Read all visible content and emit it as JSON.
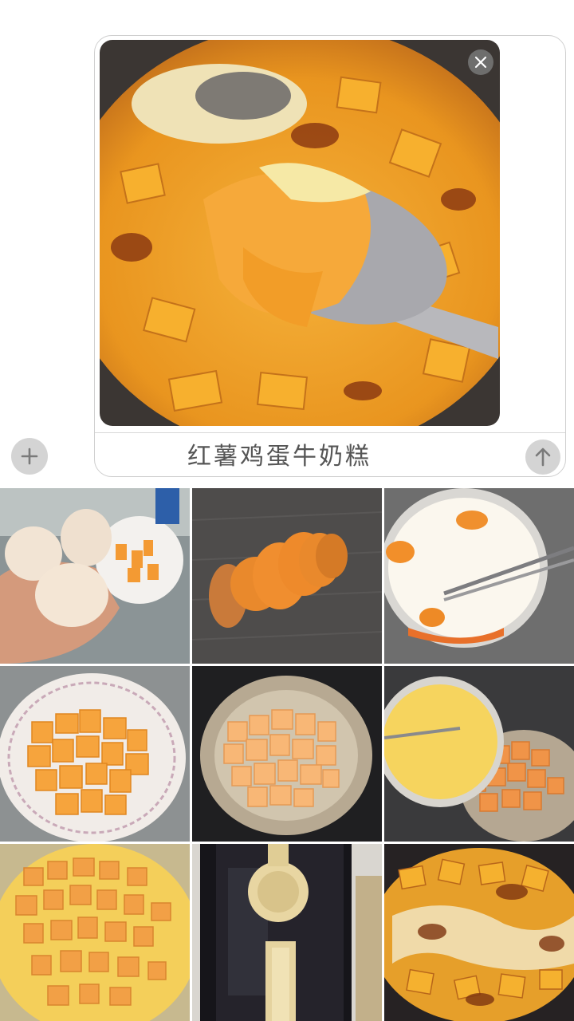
{
  "composer": {
    "message_text": "红薯鸡蛋牛奶糕",
    "attachment_icon": "photo-attachment",
    "remove_icon": "close-icon",
    "send_icon": "arrow-up-icon"
  },
  "toolbar": {
    "add_icon": "plus-icon"
  },
  "photo_grid": {
    "rows": 3,
    "columns": 3,
    "tiles": [
      "eggs-in-hand",
      "sliced-sweet-potato",
      "milk-egg-mixture",
      "diced-sweet-potato-plate",
      "sweet-potato-in-fryer-basket",
      "pouring-mixture",
      "batter-before-baking",
      "air-fryer",
      "baked-cake"
    ]
  },
  "colors": {
    "accent_gray": "#d4d4d4",
    "border": "#cfcfcf",
    "text": "#555555"
  }
}
